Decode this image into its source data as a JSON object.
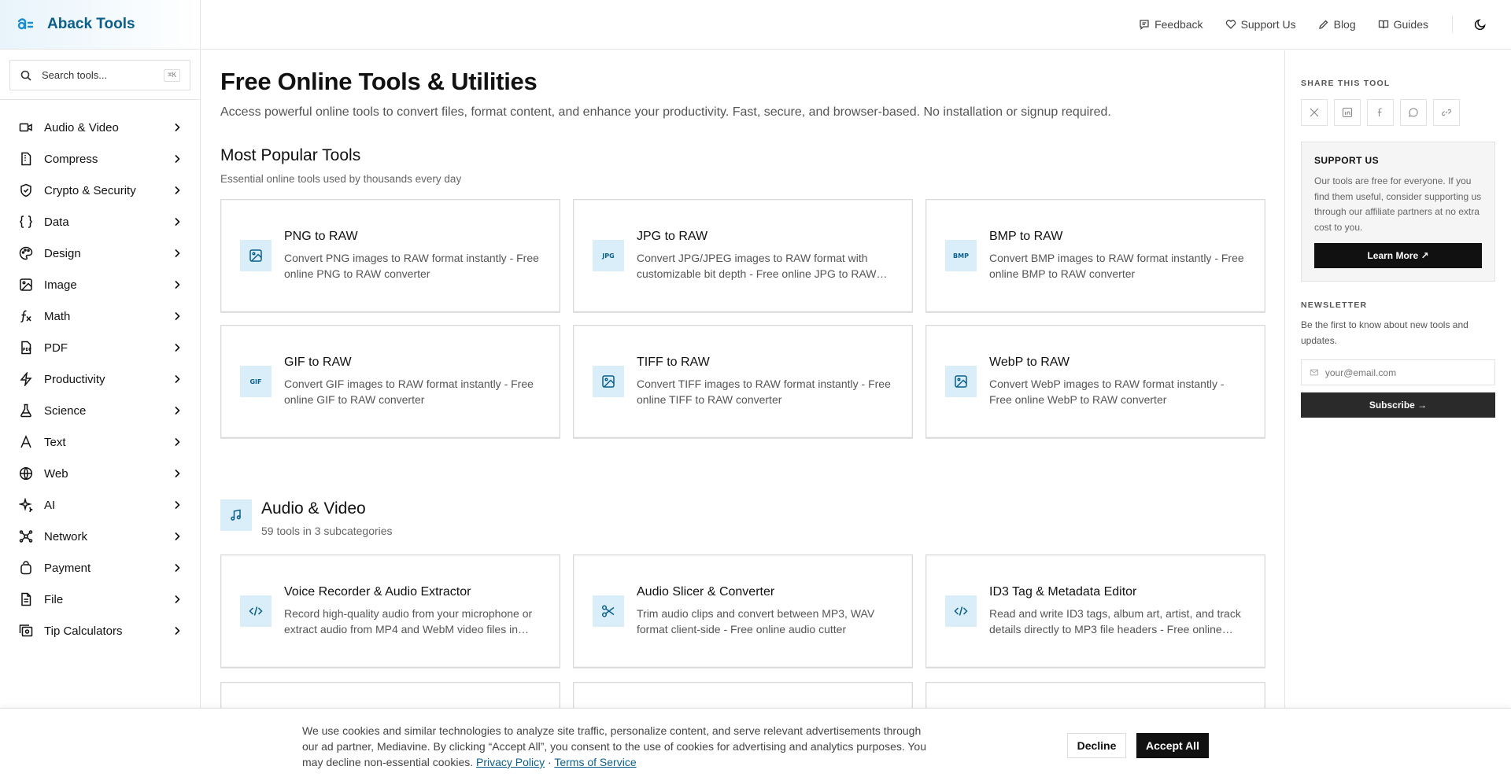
{
  "brand": {
    "name": "Aback Tools"
  },
  "search": {
    "placeholder": "Search tools...",
    "shortcut": "⌘K"
  },
  "sidebar": {
    "items": [
      {
        "label": "Audio & Video",
        "icon": "video-icon"
      },
      {
        "label": "Compress",
        "icon": "file-archive-icon"
      },
      {
        "label": "Crypto & Security",
        "icon": "shield-icon"
      },
      {
        "label": "Data",
        "icon": "braces-icon"
      },
      {
        "label": "Design",
        "icon": "palette-icon"
      },
      {
        "label": "Image",
        "icon": "image-icon"
      },
      {
        "label": "Math",
        "icon": "function-icon"
      },
      {
        "label": "PDF",
        "icon": "pdf-icon"
      },
      {
        "label": "Productivity",
        "icon": "zap-icon"
      },
      {
        "label": "Science",
        "icon": "flask-icon"
      },
      {
        "label": "Text",
        "icon": "text-icon"
      },
      {
        "label": "Web",
        "icon": "globe-icon"
      },
      {
        "label": "AI",
        "icon": "sparkles-icon"
      },
      {
        "label": "Network",
        "icon": "network-icon"
      },
      {
        "label": "Payment",
        "icon": "wallet-icon"
      },
      {
        "label": "File",
        "icon": "file-icon"
      },
      {
        "label": "Tip Calculators",
        "icon": "receipt-icon"
      }
    ]
  },
  "header": {
    "links": [
      {
        "label": "Feedback",
        "icon": "message-icon"
      },
      {
        "label": "Support Us",
        "icon": "heart-icon"
      },
      {
        "label": "Blog",
        "icon": "pencil-icon"
      },
      {
        "label": "Guides",
        "icon": "book-icon"
      }
    ],
    "theme_icon": "moon-icon"
  },
  "main": {
    "title": "Free Online Tools & Utilities",
    "description": "Access powerful online tools to convert files, format content, and enhance your productivity. Fast, secure, and browser-based. No installation or signup required.",
    "popular": {
      "title": "Most Popular Tools",
      "subtitle": "Essential online tools used by thousands every day",
      "tools": [
        {
          "title": "PNG to RAW",
          "desc": "Convert PNG images to RAW format instantly - Free online PNG to RAW converter",
          "icon": "image-icon"
        },
        {
          "title": "JPG to RAW",
          "desc": "Convert JPG/JPEG images to RAW format with customizable bit depth - Free online JPG to RAW converter",
          "icon": "jpg-icon",
          "badge": "JPG"
        },
        {
          "title": "BMP to RAW",
          "desc": "Convert BMP images to RAW format instantly - Free online BMP to RAW converter",
          "icon": "bmp-icon",
          "badge": "BMP"
        },
        {
          "title": "GIF to RAW",
          "desc": "Convert GIF images to RAW format instantly - Free online GIF to RAW converter",
          "icon": "gif-icon",
          "badge": "GIF"
        },
        {
          "title": "TIFF to RAW",
          "desc": "Convert TIFF images to RAW format instantly - Free online TIFF to RAW converter",
          "icon": "image-icon"
        },
        {
          "title": "WebP to RAW",
          "desc": "Convert WebP images to RAW format instantly - Free online WebP to RAW converter",
          "icon": "image-icon"
        }
      ]
    },
    "audio_video": {
      "title": "Audio & Video",
      "subtitle": "59 tools in 3 subcategories",
      "tools": [
        {
          "title": "Voice Recorder & Audio Extractor",
          "desc": "Record high-quality audio from your microphone or extract audio from MP4 and WebM video files in your browser",
          "icon": "code-icon"
        },
        {
          "title": "Audio Slicer & Converter",
          "desc": "Trim audio clips and convert between MP3, WAV format client-side - Free online audio cutter",
          "icon": "scissors-icon"
        },
        {
          "title": "ID3 Tag & Metadata Editor",
          "desc": "Read and write ID3 tags, album art, artist, and track details directly to MP3 file headers - Free online editor",
          "icon": "code-icon"
        }
      ]
    }
  },
  "right": {
    "share_label": "SHARE THIS TOOL",
    "share_icons": [
      "x-icon",
      "linkedin-icon",
      "facebook-icon",
      "whatsapp-icon",
      "link-icon"
    ],
    "support": {
      "title": "SUPPORT US",
      "text": "Our tools are free for everyone. If you find them useful, consider supporting us through our affiliate partners at no extra cost to you.",
      "button": "Learn More ↗"
    },
    "newsletter": {
      "label": "NEWSLETTER",
      "text": "Be the first to know about new tools and updates.",
      "placeholder": "your@email.com",
      "button": "Subscribe →"
    }
  },
  "cookie": {
    "text": "We use cookies and similar technologies to analyze site traffic, personalize content, and serve relevant advertisements through our ad partner, Mediavine. By clicking “Accept All”, you consent to the use of cookies for advertising and analytics purposes. You may decline non-essential cookies.",
    "privacy": "Privacy Policy",
    "separator": "·",
    "terms": "Terms of Service",
    "decline": "Decline",
    "accept": "Accept All"
  },
  "colors": {
    "accent": "#0b5f8a",
    "icon_bg": "#d9eef9"
  }
}
